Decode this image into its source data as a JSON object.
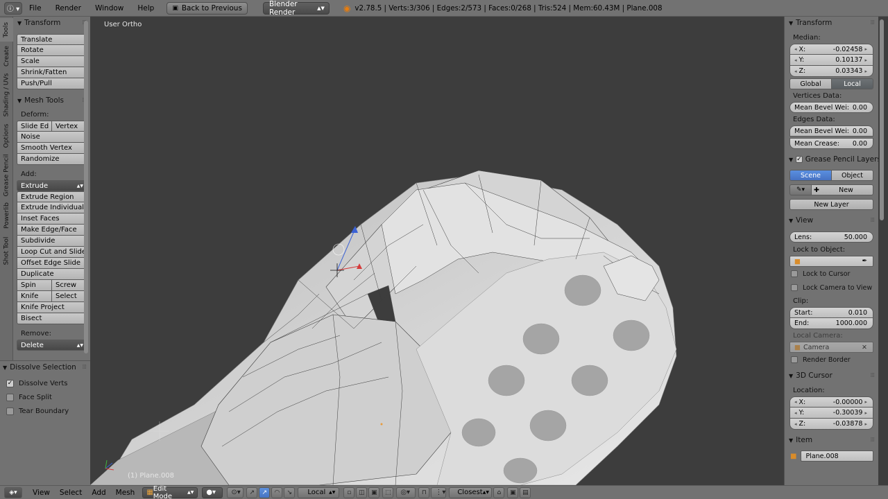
{
  "topbar": {
    "editor_icon": "info-icon",
    "menus": [
      "File",
      "Render",
      "Window",
      "Help"
    ],
    "back_button": "Back to Previous",
    "engine": "Blender Render",
    "stats": "v2.78.5 | Verts:3/306 | Edges:2/573 | Faces:0/268 | Tris:524 | Mem:60.43M | Plane.008"
  },
  "tabs": [
    "Tools",
    "Create",
    "Shading / UVs",
    "Options",
    "Grease Pencil",
    "Powerlib",
    "Shot Tool"
  ],
  "toolshelf": {
    "transform": {
      "title": "Transform",
      "buttons": [
        "Translate",
        "Rotate",
        "Scale",
        "Shrink/Fatten",
        "Push/Pull"
      ]
    },
    "mesh_tools": {
      "title": "Mesh Tools",
      "deform_label": "Deform:",
      "slide_edge": "Slide Ed",
      "vertex": "Vertex",
      "deform_buttons": [
        "Noise",
        "Smooth Vertex",
        "Randomize"
      ],
      "add_label": "Add:",
      "extrude": "Extrude",
      "add_buttons": [
        "Extrude Region",
        "Extrude Individual",
        "Inset Faces",
        "Make Edge/Face",
        "Subdivide",
        "Loop Cut and Slide",
        "Offset Edge Slide",
        "Duplicate"
      ],
      "spin": "Spin",
      "screw": "Screw",
      "knife": "Knife",
      "select": "Select",
      "knife_project": "Knife Project",
      "bisect": "Bisect",
      "remove_label": "Remove:",
      "delete": "Delete"
    }
  },
  "operator": {
    "title": "Dissolve Selection",
    "options": [
      {
        "label": "Dissolve Verts",
        "checked": true
      },
      {
        "label": "Face Split",
        "checked": false
      },
      {
        "label": "Tear Boundary",
        "checked": false
      }
    ]
  },
  "viewport": {
    "view_name": "User Ortho",
    "object_label": "(1) Plane.008"
  },
  "props": {
    "transform_title": "Transform",
    "median_label": "Median:",
    "median": [
      {
        "axis": "X:",
        "value": "-0.02458"
      },
      {
        "axis": "Y:",
        "value": "0.10137"
      },
      {
        "axis": "Z:",
        "value": "0.03343"
      }
    ],
    "space_global": "Global",
    "space_local": "Local",
    "vertices_data_label": "Vertices Data:",
    "vert_bevel_label": "Mean Bevel Wei:",
    "vert_bevel_value": "0.00",
    "edges_data_label": "Edges Data:",
    "edge_bevel_label": "Mean Bevel Wei:",
    "edge_bevel_value": "0.00",
    "crease_label": "Mean Crease:",
    "crease_value": "0.00",
    "grease_title": "Grease Pencil Layers",
    "gp_scene": "Scene",
    "gp_object": "Object",
    "gp_new": "New",
    "gp_new_layer": "New Layer",
    "view_title": "View",
    "lens_label": "Lens:",
    "lens_value": "50.000",
    "lock_object_label": "Lock to Object:",
    "lock_cursor": "Lock to Cursor",
    "lock_camera": "Lock Camera to View",
    "clip_label": "Clip:",
    "clip_start_label": "Start:",
    "clip_start": "0.010",
    "clip_end_label": "End:",
    "clip_end": "1000.000",
    "local_camera_label": "Local Camera:",
    "camera_placeholder": "Camera",
    "render_border": "Render Border",
    "cursor_title": "3D Cursor",
    "location_label": "Location:",
    "cursor": [
      {
        "axis": "X:",
        "value": "-0.00000"
      },
      {
        "axis": "Y:",
        "value": "-0.30039"
      },
      {
        "axis": "Z:",
        "value": "-0.03878"
      }
    ],
    "item_title": "Item",
    "item_name": "Plane.008"
  },
  "bottombar": {
    "menus": [
      "View",
      "Select",
      "Add",
      "Mesh"
    ],
    "mode": "Edit Mode",
    "pivot_orientation": "Local",
    "snap_target": "Closest"
  }
}
